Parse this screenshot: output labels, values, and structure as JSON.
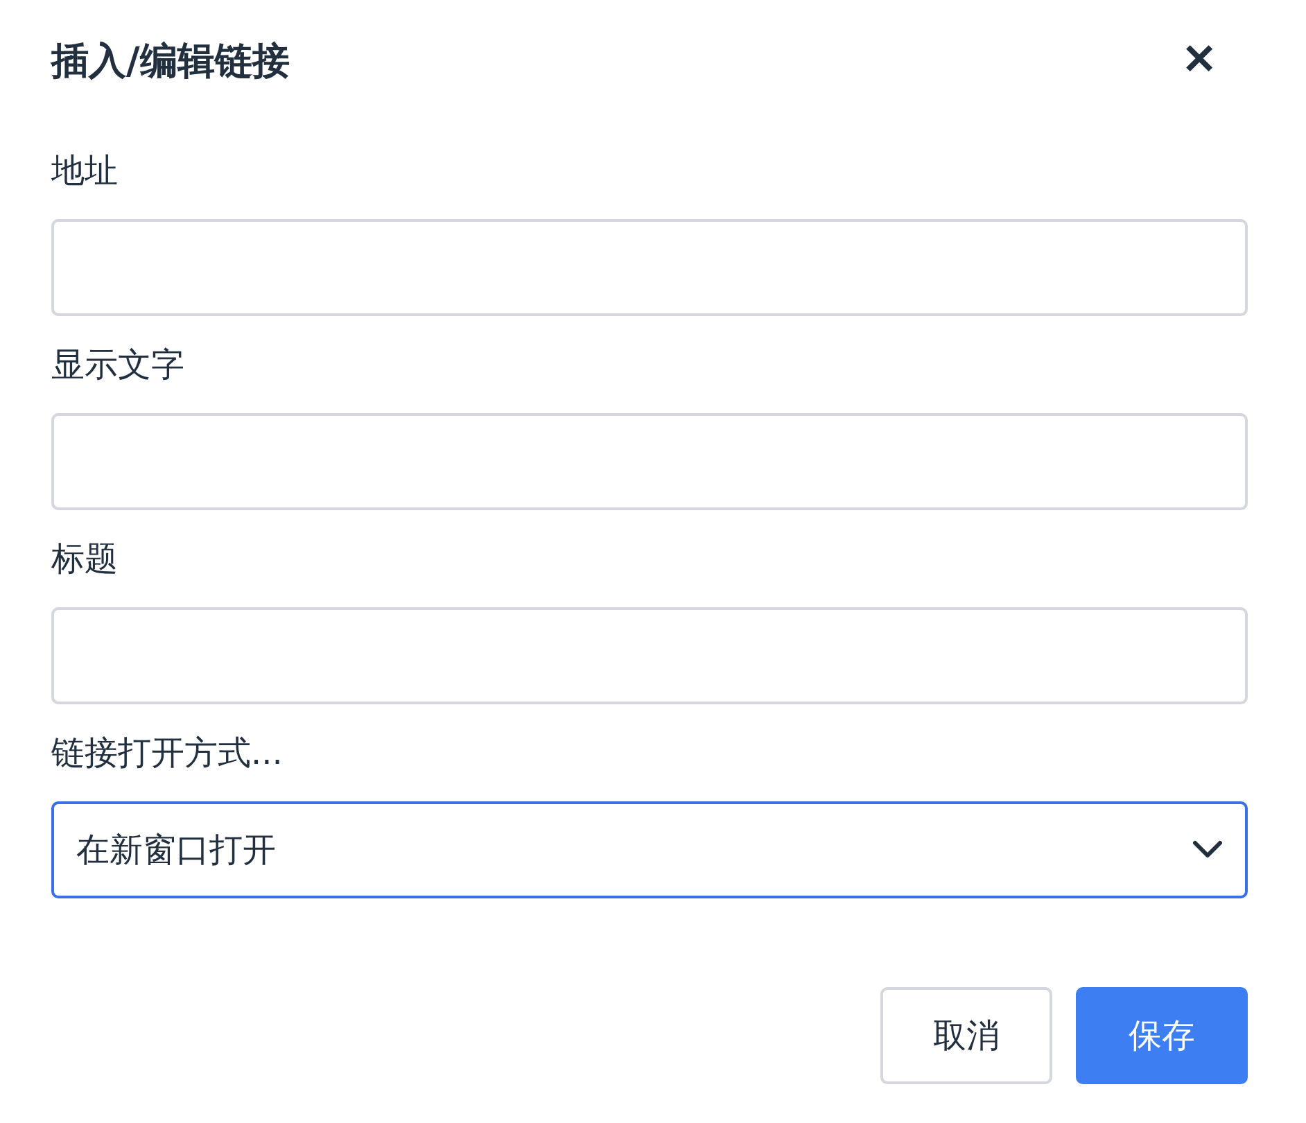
{
  "dialog": {
    "title": "插入/编辑链接",
    "close_icon": "✕"
  },
  "fields": [
    {
      "kind": "text",
      "label": "地址"
    },
    {
      "kind": "text",
      "label": "显示文字"
    },
    {
      "kind": "text",
      "label": "标题"
    },
    {
      "kind": "select",
      "label": "链接打开方式...",
      "value": "在新窗口打开",
      "focused": true
    }
  ],
  "buttons": [
    {
      "label": "取消",
      "primary": false
    },
    {
      "label": "保存",
      "primary": true
    }
  ]
}
